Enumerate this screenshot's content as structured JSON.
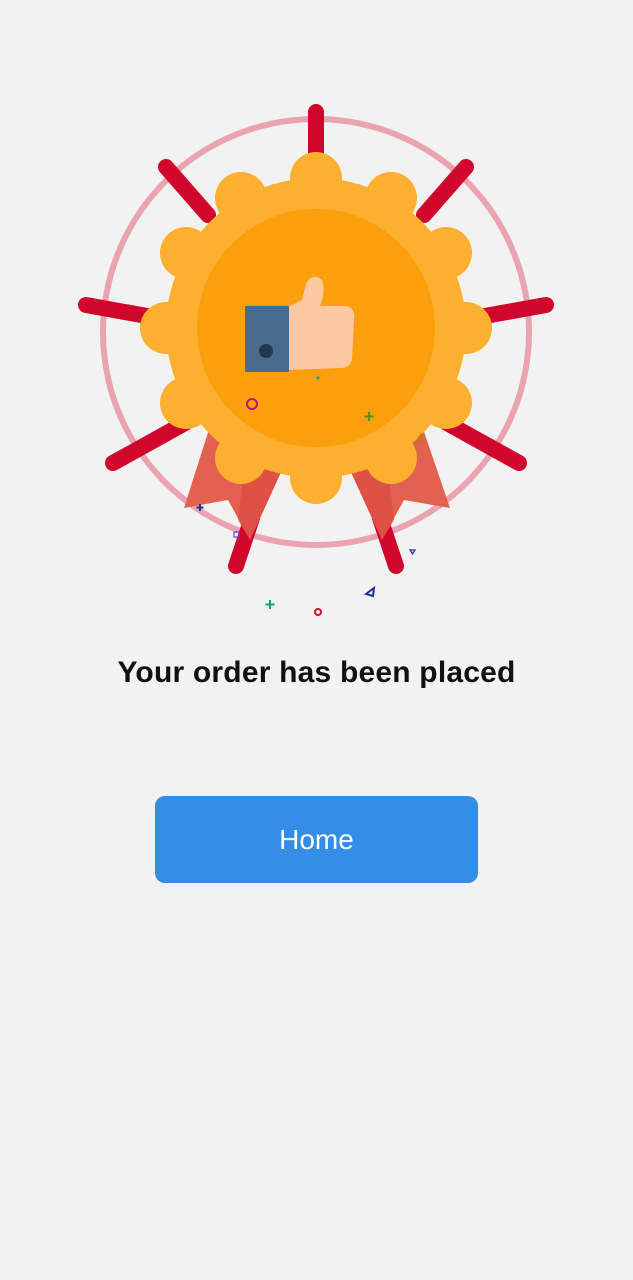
{
  "illustration": {
    "icon": "thumbs-up-medal-icon",
    "colors": {
      "rays": "#d0062c",
      "ring": "#e9a3b1",
      "medal_outer": "#fdb02f",
      "medal_inner": "#fb9f0d",
      "ribbon": "#e26150",
      "sleeve": "#476c8d",
      "hand": "#fdc8a2"
    }
  },
  "message": {
    "title": "Your order has been placed"
  },
  "actions": {
    "home_label": "Home",
    "home_color": "#348de6"
  }
}
